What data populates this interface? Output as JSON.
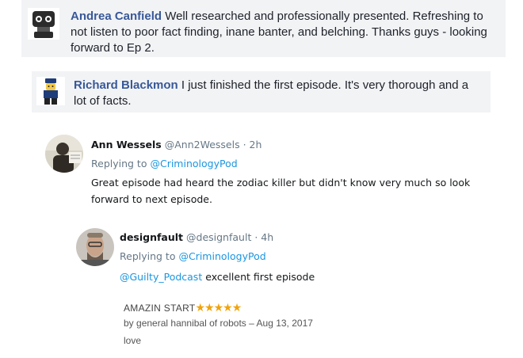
{
  "comments": [
    {
      "name": "Andrea Canfield",
      "text": "Well researched and professionally presented. Refreshing to not listen to poor fact finding, inane banter, and belching. Thanks guys - looking forward to Ep 2."
    },
    {
      "name": "Richard Blackmon",
      "text": "I just finished the first episode. It's very thorough and a lot of facts."
    }
  ],
  "tweets": [
    {
      "name": "Ann Wessels",
      "handle": "@Ann2Wessels",
      "separator": "·",
      "time": "2h",
      "replying_prefix": "Replying to",
      "replying_to": "@CriminologyPod",
      "mention": "",
      "text": "Great episode had heard the zodiac killer but didn't know very much so look forward to next episode."
    },
    {
      "name": "designfault",
      "handle": "@designfault",
      "separator": "·",
      "time": "4h",
      "replying_prefix": "Replying to",
      "replying_to": "@CriminologyPod",
      "mention": "@Guilty_Podcast",
      "text": "excellent first episode"
    }
  ],
  "review": {
    "title": "AMAZIN START",
    "stars": "★★★★★",
    "rating": 5,
    "by_prefix": "by",
    "author": "general hannibal of robots",
    "date_sep": "–",
    "date": "Aug 13, 2017",
    "body": "love"
  },
  "colors": {
    "fb_name": "#385898",
    "fb_bg": "#f2f3f5",
    "tw_link": "#1b95e0",
    "tw_meta": "#657786",
    "star": "#f0a30a"
  }
}
